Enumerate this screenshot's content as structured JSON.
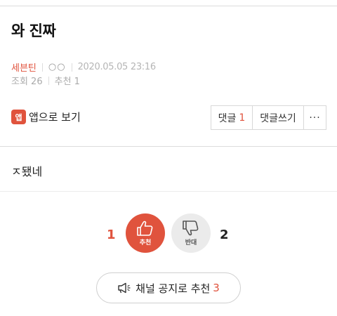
{
  "post": {
    "title": "와 진짜",
    "author": "세븐틴",
    "ip": "○○",
    "date": "2020.05.05 23:16",
    "views_label": "조회 26",
    "recommend_label": "추천 1",
    "body": "ㅈ됐네"
  },
  "actions": {
    "app_badge": "앱",
    "app_view_label": "앱으로 보기",
    "comments_label": "댓글",
    "comments_count": "1",
    "write_comment_label": "댓글쓰기",
    "more_label": "···"
  },
  "vote": {
    "up_count": "1",
    "up_label": "추천",
    "down_count": "2",
    "down_label": "반대"
  },
  "notice": {
    "label": "채널 공지로 추천",
    "count": "3"
  },
  "colors": {
    "accent": "#e0533d",
    "down_button_bg": "#ebebeb",
    "divider": "#dcdcdc"
  },
  "icons": [
    "thumbs-up-icon",
    "thumbs-down-icon",
    "megaphone-icon"
  ]
}
